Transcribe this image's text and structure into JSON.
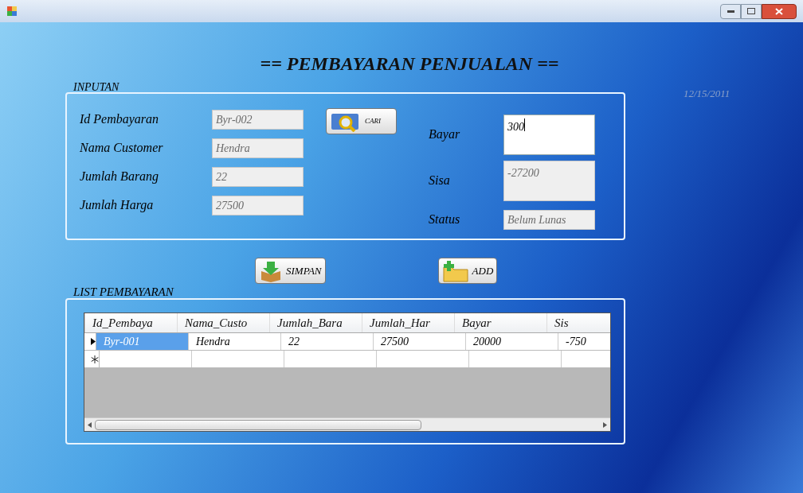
{
  "window": {
    "title": "== PEMBAYARAN PENJUALAN =="
  },
  "date": "12/15/2011",
  "inputan": {
    "legend": "INPUTAN",
    "left_fields": [
      {
        "label": "Id Pembayaran",
        "value": "Byr-002",
        "disabled": true
      },
      {
        "label": "Nama Customer",
        "value": "Hendra",
        "disabled": true
      },
      {
        "label": "Jumlah Barang",
        "value": "22",
        "disabled": true
      },
      {
        "label": "Jumlah Harga",
        "value": "27500",
        "disabled": true
      }
    ],
    "search_button": "CARI",
    "right_fields": [
      {
        "label": "Bayar",
        "value": "300",
        "disabled": false,
        "kind": "tall"
      },
      {
        "label": "Sisa",
        "value": "-27200",
        "disabled": true,
        "kind": "tall"
      },
      {
        "label": "Status",
        "value": "Belum Lunas",
        "disabled": true,
        "kind": "short"
      }
    ]
  },
  "actions": [
    {
      "label": "SIMPAN",
      "kind": "save"
    },
    {
      "label": "ADD",
      "kind": "add"
    }
  ],
  "list": {
    "legend": "LIST PEMBAYARAN",
    "columns": [
      "Id_Pembaya",
      "Nama_Custo",
      "Jumlah_Bara",
      "Jumlah_Har",
      "Bayar",
      "Sis"
    ],
    "rows": [
      {
        "kind": "data",
        "selected": true,
        "cells": [
          "Byr-001",
          "Hendra",
          "22",
          "27500",
          "20000",
          "-750"
        ]
      },
      {
        "kind": "new",
        "selected": false,
        "cells": [
          "",
          "",
          "",
          "",
          "",
          ""
        ]
      }
    ]
  }
}
